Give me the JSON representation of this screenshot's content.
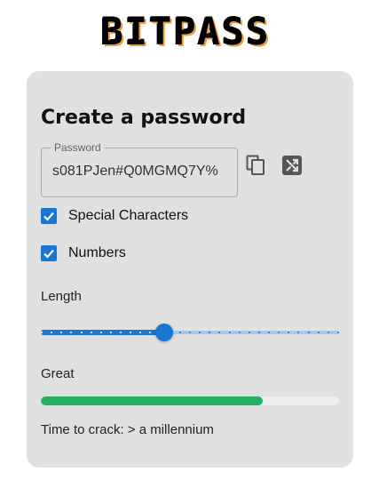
{
  "app": {
    "logo_text": "BITPASS"
  },
  "card": {
    "title": "Create a password"
  },
  "password": {
    "legend": "Password",
    "value": "s081PJen#Q0MGMQ7Y%"
  },
  "actions": {
    "copy_icon": "copy-icon",
    "shuffle_icon": "shuffle-icon"
  },
  "options": [
    {
      "label": "Special Characters",
      "checked": true
    },
    {
      "label": "Numbers",
      "checked": true
    }
  ],
  "length": {
    "label": "Length",
    "fraction": 0.415,
    "tick_count": 31
  },
  "strength": {
    "label": "Great",
    "fraction": 0.745,
    "color": "#27ae60"
  },
  "crack": {
    "text": "Time to crack: > a millennium"
  },
  "colors": {
    "accent": "#1976d2",
    "card": "#e0e0e0"
  }
}
